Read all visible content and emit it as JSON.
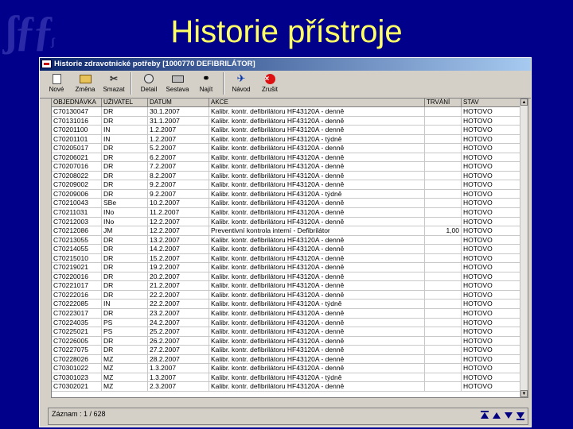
{
  "slide": {
    "title": "Historie přístroje"
  },
  "window": {
    "title": "Historie zdravotnické potřeby [1000770 DEFIBRILÁTOR]"
  },
  "toolbar": {
    "buttons": [
      {
        "label": "Nové",
        "icon": "new-document-icon"
      },
      {
        "label": "Změna",
        "icon": "edit-folder-icon"
      },
      {
        "label": "Smazat",
        "icon": "delete-icon"
      },
      {
        "label": "Detail",
        "icon": "detail-icon"
      },
      {
        "label": "Sestava",
        "icon": "print-icon"
      },
      {
        "label": "Najít",
        "icon": "binoculars-icon"
      },
      {
        "label": "Návod",
        "icon": "guide-icon"
      },
      {
        "label": "Zrušit",
        "icon": "cancel-icon"
      }
    ]
  },
  "table": {
    "columns": [
      "OBJEDNÁVKA",
      "UŽIVATEL",
      "DATUM",
      "AKCE",
      "TRVÁNÍ",
      "STAV"
    ],
    "rows": [
      [
        "C70130047",
        "DR",
        "30.1.2007",
        "Kalibr. kontr. defibrilátoru HF43120A - denně",
        "",
        "HOTOVO"
      ],
      [
        "C70131016",
        "DR",
        "31.1.2007",
        "Kalibr. kontr. defibrilátoru HF43120A - denně",
        "",
        "HOTOVO"
      ],
      [
        "C70201100",
        "IN",
        "1.2.2007",
        "Kalibr. kontr. defibrilátoru HF43120A - denně",
        "",
        "HOTOVO"
      ],
      [
        "C70201101",
        "IN",
        "1.2.2007",
        "Kalibr. kontr. defibrilátoru HF43120A - týdně",
        "",
        "HOTOVO"
      ],
      [
        "C70205017",
        "DR",
        "5.2.2007",
        "Kalibr. kontr. defibrilátoru HF43120A - denně",
        "",
        "HOTOVO"
      ],
      [
        "C70206021",
        "DR",
        "6.2.2007",
        "Kalibr. kontr. defibrilátoru HF43120A - denně",
        "",
        "HOTOVO"
      ],
      [
        "C70207016",
        "DR",
        "7.2.2007",
        "Kalibr. kontr. defibrilátoru HF43120A - denně",
        "",
        "HOTOVO"
      ],
      [
        "C70208022",
        "DR",
        "8.2.2007",
        "Kalibr. kontr. defibrilátoru HF43120A - denně",
        "",
        "HOTOVO"
      ],
      [
        "C70209002",
        "DR",
        "9.2.2007",
        "Kalibr. kontr. defibrilátoru HF43120A - denně",
        "",
        "HOTOVO"
      ],
      [
        "C70209006",
        "DR",
        "9.2.2007",
        "Kalibr. kontr. defibrilátoru HF43120A - týdně",
        "",
        "HOTOVO"
      ],
      [
        "C70210043",
        "SBe",
        "10.2.2007",
        "Kalibr. kontr. defibrilátoru HF43120A - denně",
        "",
        "HOTOVO"
      ],
      [
        "C70211031",
        "INo",
        "11.2.2007",
        "Kalibr. kontr. defibrilátoru HF43120A - denně",
        "",
        "HOTOVO"
      ],
      [
        "C70212003",
        "INo",
        "12.2.2007",
        "Kalibr. kontr. defibrilátoru HF43120A - denně",
        "",
        "HOTOVO"
      ],
      [
        "C70212086",
        "JM",
        "12.2.2007",
        "Preventivní kontrola interní - Defibrilátor",
        "1,00",
        "HOTOVO"
      ],
      [
        "C70213055",
        "DR",
        "13.2.2007",
        "Kalibr. kontr. defibrilátoru HF43120A - denně",
        "",
        "HOTOVO"
      ],
      [
        "C70214055",
        "DR",
        "14.2.2007",
        "Kalibr. kontr. defibrilátoru HF43120A - denně",
        "",
        "HOTOVO"
      ],
      [
        "C70215010",
        "DR",
        "15.2.2007",
        "Kalibr. kontr. defibrilátoru HF43120A - denně",
        "",
        "HOTOVO"
      ],
      [
        "C70219021",
        "DR",
        "19.2.2007",
        "Kalibr. kontr. defibrilátoru HF43120A - denně",
        "",
        "HOTOVO"
      ],
      [
        "C70220016",
        "DR",
        "20.2.2007",
        "Kalibr. kontr. defibrilátoru HF43120A - denně",
        "",
        "HOTOVO"
      ],
      [
        "C70221017",
        "DR",
        "21.2.2007",
        "Kalibr. kontr. defibrilátoru HF43120A - denně",
        "",
        "HOTOVO"
      ],
      [
        "C70222016",
        "DR",
        "22.2.2007",
        "Kalibr. kontr. defibrilátoru HF43120A - denně",
        "",
        "HOTOVO"
      ],
      [
        "C70222085",
        "IN",
        "22.2.2007",
        "Kalibr. kontr. defibrilátoru HF43120A - týdně",
        "",
        "HOTOVO"
      ],
      [
        "C70223017",
        "DR",
        "23.2.2007",
        "Kalibr. kontr. defibrilátoru HF43120A - denně",
        "",
        "HOTOVO"
      ],
      [
        "C70224035",
        "PS",
        "24.2.2007",
        "Kalibr. kontr. defibrilátoru HF43120A - denně",
        "",
        "HOTOVO"
      ],
      [
        "C70225021",
        "PS",
        "25.2.2007",
        "Kalibr. kontr. defibrilátoru HF43120A - denně",
        "",
        "HOTOVO"
      ],
      [
        "C70226005",
        "DR",
        "26.2.2007",
        "Kalibr. kontr. defibrilátoru HF43120A - denně",
        "",
        "HOTOVO"
      ],
      [
        "C70227075",
        "DR",
        "27.2.2007",
        "Kalibr. kontr. defibrilátoru HF43120A - denně",
        "",
        "HOTOVO"
      ],
      [
        "C70228026",
        "MZ",
        "28.2.2007",
        "Kalibr. kontr. defibrilátoru HF43120A - denně",
        "",
        "HOTOVO"
      ],
      [
        "C70301022",
        "MZ",
        "1.3.2007",
        "Kalibr. kontr. defibrilátoru HF43120A - denně",
        "",
        "HOTOVO"
      ],
      [
        "C70301023",
        "MZ",
        "1.3.2007",
        "Kalibr. kontr. defibrilátoru HF43120A - týdně",
        "",
        "HOTOVO"
      ],
      [
        "C70302021",
        "MZ",
        "2.3.2007",
        "Kalibr. kontr. defibrilátoru HF43120A - denně",
        "",
        "HOTOVO"
      ]
    ]
  },
  "status": {
    "text": "Záznam : 1 / 628"
  },
  "colors": {
    "slide_background": "#00008a",
    "title": "#ffff66",
    "window": "#d4d0c8",
    "titlebar": "#0a246a"
  }
}
